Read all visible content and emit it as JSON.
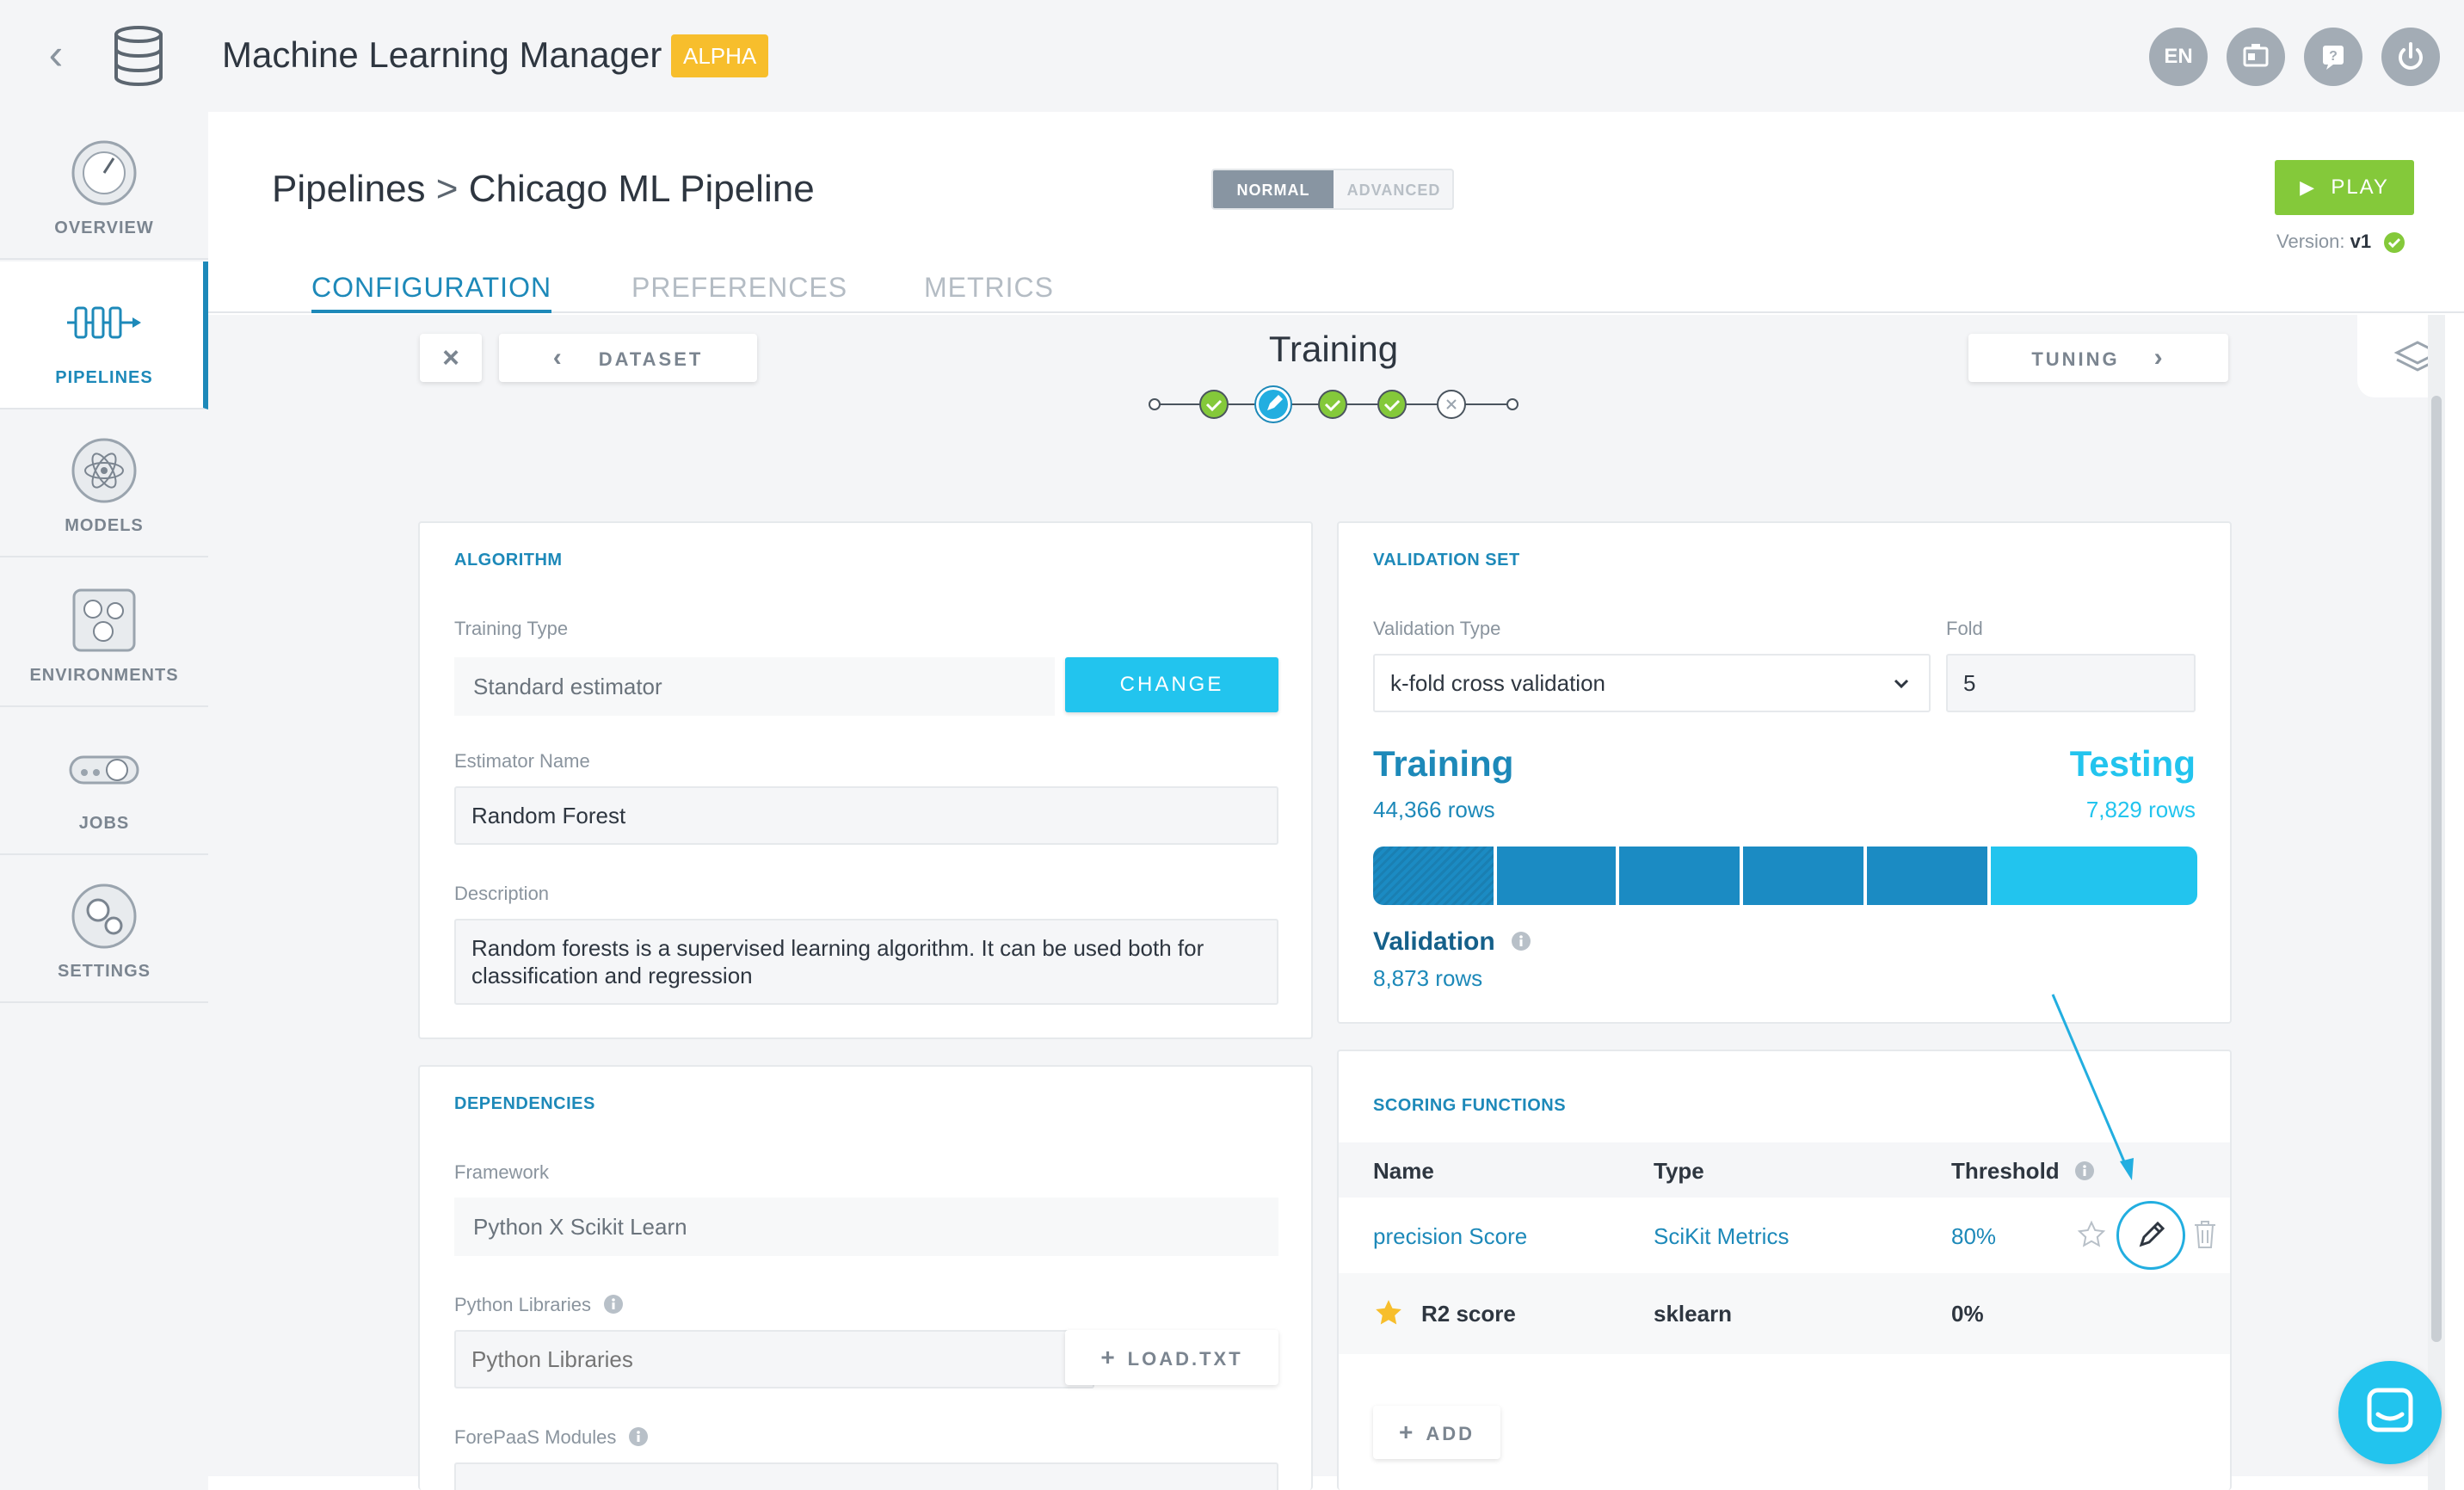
{
  "app": {
    "title": "Machine Learning Manager",
    "badge": "ALPHA"
  },
  "top_actions": [
    {
      "label": "EN",
      "icon": "language-icon"
    },
    {
      "label": "",
      "icon": "id-card-icon"
    },
    {
      "label": "",
      "icon": "help-icon"
    },
    {
      "label": "",
      "icon": "power-icon"
    }
  ],
  "sidebar": {
    "items": [
      {
        "label": "OVERVIEW",
        "icon": "gauge-icon",
        "active": false
      },
      {
        "label": "PIPELINES",
        "icon": "pipeline-icon",
        "active": true
      },
      {
        "label": "MODELS",
        "icon": "atom-icon",
        "active": false
      },
      {
        "label": "ENVIRONMENTS",
        "icon": "network-icon",
        "active": false
      },
      {
        "label": "JOBS",
        "icon": "conveyor-icon",
        "active": false
      },
      {
        "label": "SETTINGS",
        "icon": "gears-icon",
        "active": false
      }
    ]
  },
  "header": {
    "breadcrumb_root": "Pipelines",
    "breadcrumb_sep": ">",
    "breadcrumb_current": "Chicago ML Pipeline",
    "mode_normal": "NORMAL",
    "mode_advanced": "ADVANCED",
    "play_label": "PLAY",
    "version_label": "Version:",
    "version_value": "v1"
  },
  "tabs": [
    {
      "label": "CONFIGURATION",
      "active": true
    },
    {
      "label": "PREFERENCES",
      "active": false
    },
    {
      "label": "METRICS",
      "active": false
    }
  ],
  "wizard": {
    "close_label": "×",
    "prev_label": "DATASET",
    "next_label": "TUNING",
    "step_title": "Training",
    "steps": [
      "done",
      "current",
      "done",
      "done",
      "error"
    ]
  },
  "algorithm": {
    "title": "ALGORITHM",
    "training_type_label": "Training Type",
    "training_type_value": "Standard estimator",
    "change_label": "CHANGE",
    "estimator_label": "Estimator Name",
    "estimator_value": "Random Forest",
    "description_label": "Description",
    "description_value": "Random forests is a supervised learning algorithm. It can be used both for classification and regression"
  },
  "dependencies": {
    "title": "DEPENDENCIES",
    "framework_label": "Framework",
    "framework_value": "Python X Scikit Learn",
    "libraries_label": "Python Libraries",
    "libraries_placeholder": "Python Libraries",
    "load_label": "LOAD.TXT",
    "modules_label": "ForePaaS Modules"
  },
  "validation": {
    "title": "VALIDATION SET",
    "type_label": "Validation Type",
    "type_value": "k-fold cross validation",
    "fold_label": "Fold",
    "fold_value": "5",
    "training_label": "Training",
    "training_rows": "44,366 rows",
    "testing_label": "Testing",
    "testing_rows": "7,829 rows",
    "validation_label": "Validation",
    "validation_rows": "8,873 rows",
    "colors": {
      "training": "#1b8bc3",
      "testing": "#22c4ee"
    }
  },
  "scoring": {
    "title": "SCORING FUNCTIONS",
    "columns": [
      "Name",
      "Type",
      "Threshold"
    ],
    "rows": [
      {
        "name": "precision Score",
        "type": "SciKit Metrics",
        "threshold": "80%",
        "starred": false
      },
      {
        "name": "R2 score",
        "type": "sklearn",
        "threshold": "0%",
        "starred": true
      }
    ],
    "add_label": "ADD"
  },
  "accent_colors": {
    "primary": "#1d89b9",
    "cyan": "#22c4ee",
    "green": "#84c93a",
    "alpha": "#f7be2c"
  }
}
